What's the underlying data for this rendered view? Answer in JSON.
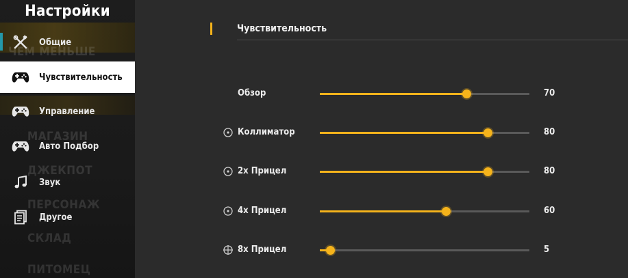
{
  "sidebar": {
    "title": "Настройки",
    "items": [
      {
        "label": "Общие",
        "icon": "tools-icon",
        "active": false
      },
      {
        "label": "Чувствительность",
        "icon": "gamepad-icon",
        "active": true
      },
      {
        "label": "Управление",
        "icon": "gamepad-icon",
        "active": false
      },
      {
        "label": "Авто Подбор",
        "icon": "gamepad-icon",
        "active": false
      },
      {
        "label": "Звук",
        "icon": "music-note-icon",
        "active": false
      },
      {
        "label": "Другое",
        "icon": "document-icon",
        "active": false
      }
    ],
    "background_text": [
      "ЧЕМ МЕНЬШЕ",
      "МАГАЗИН",
      "ДЖЕКПОТ",
      "ПЕРСОНАЖ",
      "СКЛАД",
      "ПИТОМЕЦ"
    ]
  },
  "main": {
    "section_title": "Чувствительность",
    "sliders": [
      {
        "label": "Обзор",
        "value": 70,
        "icon": null
      },
      {
        "label": "Коллиматор",
        "value": 80,
        "icon": "red-dot-sight-icon"
      },
      {
        "label": "2x Прицел",
        "value": 80,
        "icon": "scope-2x-icon"
      },
      {
        "label": "4x Прицел",
        "value": 60,
        "icon": "scope-4x-icon"
      },
      {
        "label": "8x Прицел",
        "value": 5,
        "icon": "crosshair-icon"
      }
    ],
    "slider_max": 100
  },
  "colors": {
    "accent": "#f5b31b",
    "active_item_bg": "#ffffff",
    "panel_bg": "#2b2b2b",
    "sidebar_bg": "#1b1b1b"
  }
}
